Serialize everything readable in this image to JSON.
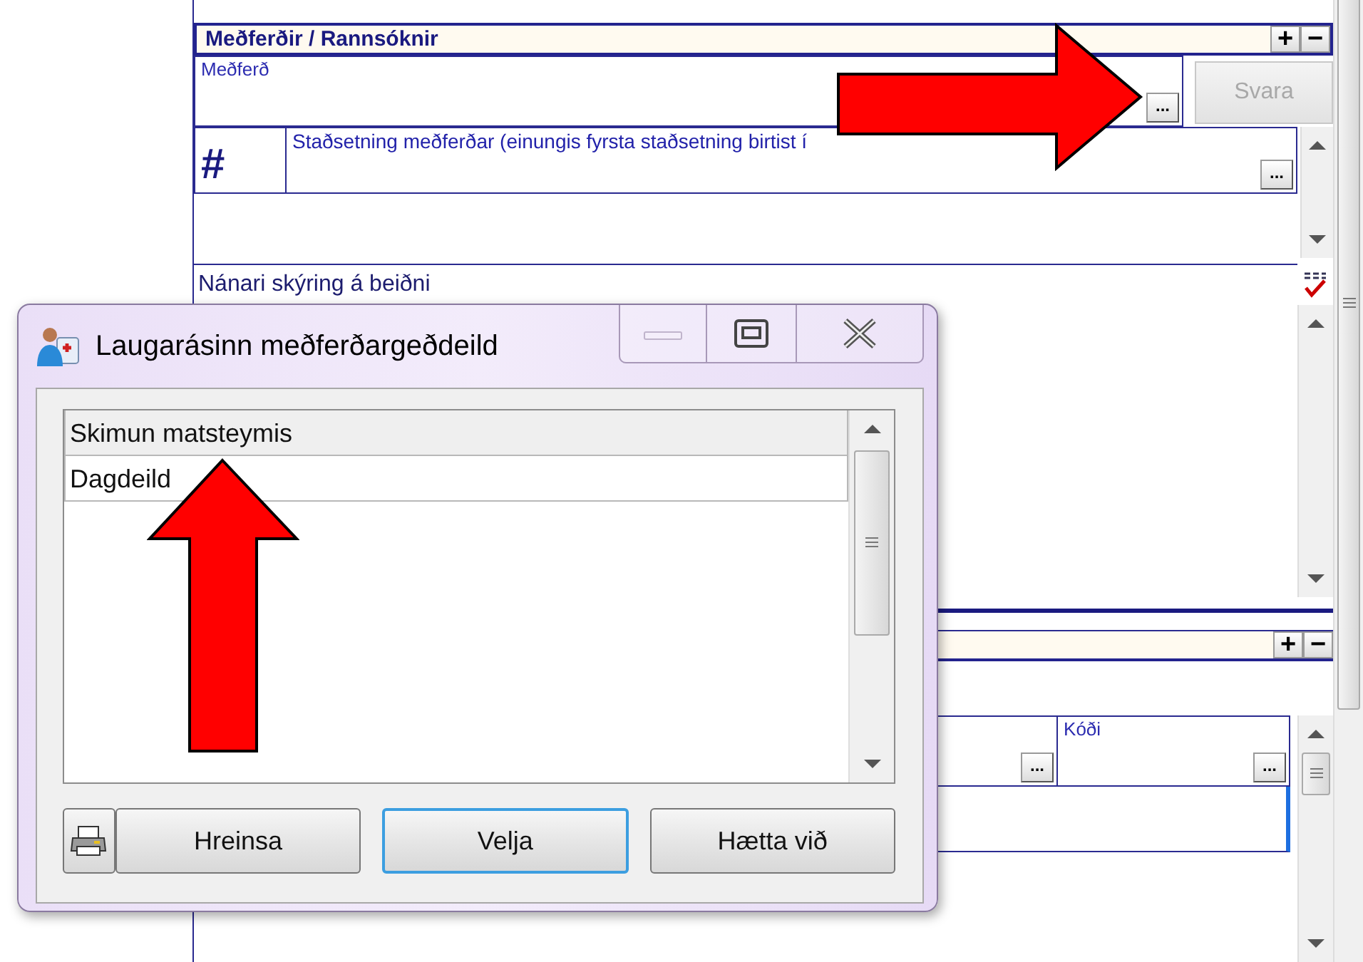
{
  "form": {
    "sections": [
      {
        "title": "Meðferðir / Rannsóknir",
        "expand_label": "+",
        "collapse_label": "−"
      },
      {
        "expand_label": "+",
        "collapse_label": "−"
      }
    ],
    "treatment_field": {
      "label": "Meðferð",
      "browse_label": "..."
    },
    "answer_button": {
      "label": "Svara",
      "disabled": true
    },
    "location_field": {
      "marker": "#",
      "label": "Staðsetning meðferðar (einungis fyrsta staðsetning birtist í",
      "browse_label": "..."
    },
    "details_field": {
      "label": "Nánari skýring á beiðni"
    },
    "code_fields": [
      {
        "browse_label": "..."
      },
      {
        "label": "Kóði",
        "browse_label": "..."
      }
    ]
  },
  "dialog": {
    "title": "Laugarásinn meðferðargeðdeild",
    "items": [
      {
        "label": "Skimun matsteymis",
        "selected": true
      },
      {
        "label": "Dagdeild",
        "selected": false
      }
    ],
    "buttons": [
      {
        "kind": "print"
      },
      {
        "kind": "text",
        "label": "Hreinsa",
        "default": false
      },
      {
        "kind": "text",
        "label": "Velja",
        "default": true
      },
      {
        "kind": "text",
        "label": "Hætta við",
        "default": false
      }
    ]
  },
  "annotations": [
    {
      "kind": "arrow_right"
    },
    {
      "kind": "arrow_up"
    }
  ]
}
